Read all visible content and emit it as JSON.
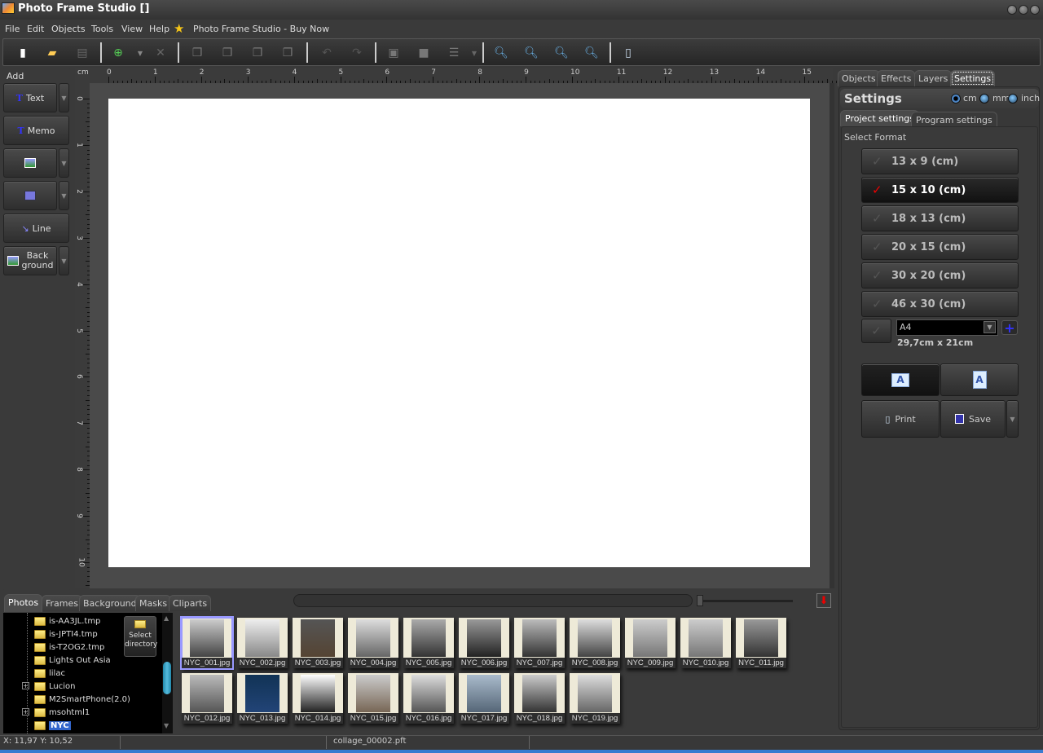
{
  "window": {
    "title": "Photo Frame Studio []"
  },
  "menu": [
    "File",
    "Edit",
    "Objects",
    "Tools",
    "View",
    "Help"
  ],
  "buy_now": "Photo Frame Studio - Buy Now",
  "toolbar": {
    "buttons": [
      "new-icon",
      "open-icon",
      "save-disabled-icon",
      "add-icon",
      "add-dropdown-icon",
      "delete-icon",
      "bring-front-icon",
      "bring-forward-icon",
      "send-backward-icon",
      "send-back-icon",
      "undo-icon",
      "redo-icon",
      "group-icon",
      "ungroup-icon",
      "align-icon",
      "zoom-fit-icon",
      "zoom-100-icon",
      "zoom-out-icon",
      "zoom-in-icon",
      "print-preview-icon"
    ]
  },
  "add_panel": {
    "label": "Add",
    "text": "Text",
    "memo": "Memo",
    "line": "Line",
    "background_1": "Back",
    "background_2": "ground"
  },
  "ruler": {
    "unit": "cm",
    "h_ticks": [
      "0",
      "1",
      "2",
      "3",
      "4",
      "5",
      "6",
      "7",
      "8",
      "9",
      "10",
      "11",
      "12",
      "13",
      "14",
      "15"
    ],
    "v_ticks": [
      "0",
      "1",
      "2",
      "3",
      "4",
      "5",
      "6",
      "7",
      "8",
      "9",
      "10"
    ]
  },
  "right_panel": {
    "tabs": [
      "Objects",
      "Effects",
      "Layers",
      "Settings"
    ],
    "active_tab": "Settings",
    "title": "Settings",
    "units": [
      "cm",
      "mm",
      "inch"
    ],
    "selected_unit": "cm",
    "subtabs": [
      "Project settings",
      "Program settings"
    ],
    "select_format": "Select Format",
    "formats": [
      "13 x 9 (cm)",
      "15 x 10 (cm)",
      "18 x 13 (cm)",
      "20 x 15 (cm)",
      "30 x 20 (cm)",
      "46 x 30 (cm)"
    ],
    "selected_format": "15 x 10 (cm)",
    "custom_format": "A4",
    "custom_dims": "29,7cm x 21cm",
    "orientation_icon": "A",
    "print": "Print",
    "save": "Save"
  },
  "bottom": {
    "tabs": [
      "Photos",
      "Frames",
      "Background",
      "Masks",
      "Cliparts"
    ],
    "active_tab": "Photos",
    "tree": [
      {
        "label": "is-AA3JL.tmp",
        "expand": false
      },
      {
        "label": "is-JPTI4.tmp",
        "expand": false
      },
      {
        "label": "is-T2OG2.tmp",
        "expand": false
      },
      {
        "label": "Lights Out Asia",
        "expand": false
      },
      {
        "label": "lilac",
        "expand": false
      },
      {
        "label": "Lucion",
        "expand": true
      },
      {
        "label": "M2SmartPhone(2.0)",
        "expand": false
      },
      {
        "label": "msohtml1",
        "expand": true
      },
      {
        "label": "NYC",
        "expand": false,
        "selected": true
      }
    ],
    "select_dir_1": "Select",
    "select_dir_2": "directory",
    "photos": [
      "NYC_001.jpg",
      "NYC_002.jpg",
      "NYC_003.jpg",
      "NYC_004.jpg",
      "NYC_005.jpg",
      "NYC_006.jpg",
      "NYC_007.jpg",
      "NYC_008.jpg",
      "NYC_009.jpg",
      "NYC_010.jpg",
      "NYC_011.jpg",
      "NYC_012.jpg",
      "NYC_013.jpg",
      "NYC_014.jpg",
      "NYC_015.jpg",
      "NYC_016.jpg",
      "NYC_017.jpg",
      "NYC_018.jpg",
      "NYC_019.jpg"
    ],
    "selected_photo": "NYC_001.jpg"
  },
  "status": {
    "coords": "X: 11,97 Y: 10,52",
    "file": "collage_00002.pft"
  }
}
